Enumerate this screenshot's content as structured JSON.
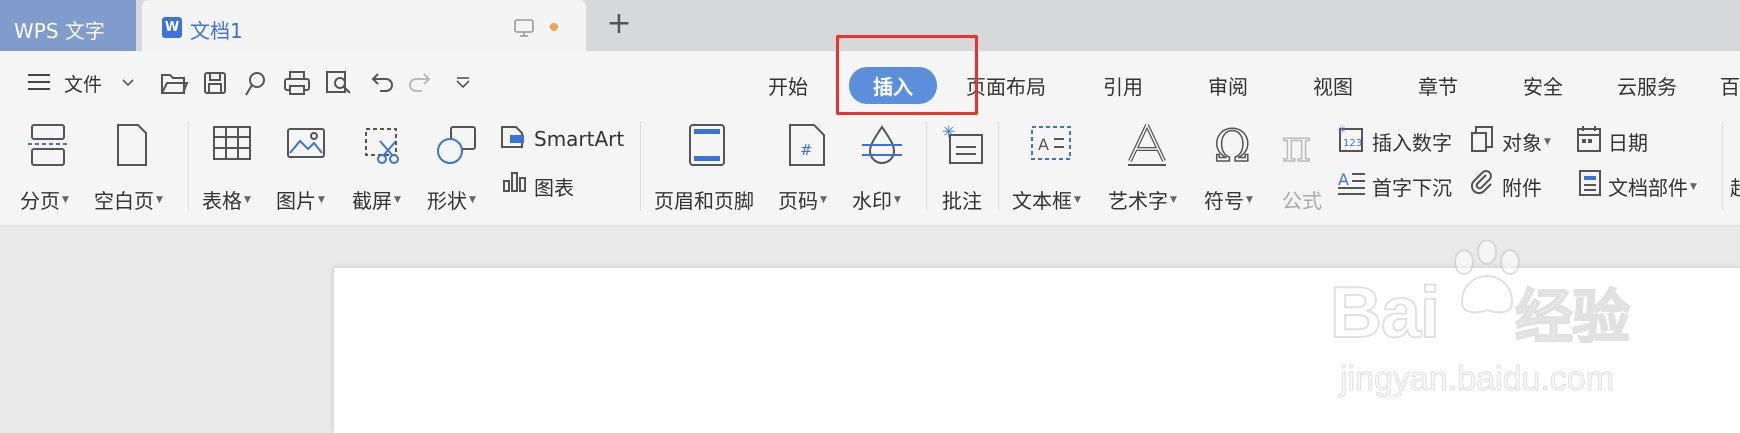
{
  "tabbar": {
    "app_name": "WPS 文字",
    "doc_icon_letter": "W",
    "doc_title": "文档1",
    "new_tab": "+"
  },
  "menubar": {
    "file_label": "文件",
    "tabs": [
      "开始",
      "插入",
      "页面布局",
      "引用",
      "审阅",
      "视图",
      "章节",
      "安全",
      "云服务",
      "百"
    ],
    "active_tab": "插入"
  },
  "ribbon": {
    "page_break": "分页",
    "blank_page": "空白页",
    "table": "表格",
    "picture": "图片",
    "screenshot": "截屏",
    "shape": "形状",
    "smartart": "SmartArt",
    "chart": "图表",
    "header_footer": "页眉和页脚",
    "page_number": "页码",
    "watermark": "水印",
    "comment": "批注",
    "textbox": "文本框",
    "wordart": "艺术字",
    "symbol": "符号",
    "formula": "公式",
    "insert_number": "插入数字",
    "object": "对象",
    "date": "日期",
    "drop_cap": "首字下沉",
    "attachment": "附件",
    "doc_parts": "文档部件",
    "more": "超"
  },
  "watermark": {
    "brand": "Bai",
    "brand_suffix": "经验",
    "url": "jingyan.baidu.com"
  },
  "colors": {
    "accent": "#5b8fdc",
    "highlight": "#e8332c",
    "app_tab": "#7f9ccd"
  }
}
